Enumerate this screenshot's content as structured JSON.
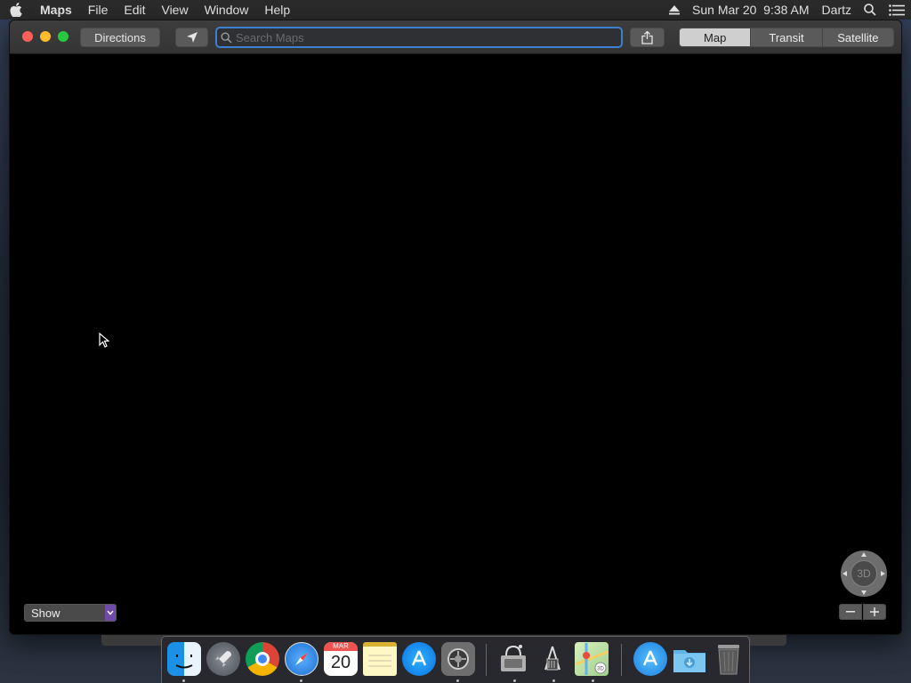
{
  "menubar": {
    "app_name": "Maps",
    "menus": [
      "File",
      "Edit",
      "View",
      "Window",
      "Help"
    ],
    "clock": "Sun Mar 20  9:38 AM",
    "user": "Dartz"
  },
  "toolbar": {
    "directions_label": "Directions",
    "search_placeholder": "Search Maps",
    "search_value": "",
    "view_modes": [
      "Map",
      "Transit",
      "Satellite"
    ],
    "active_view_mode": "Map"
  },
  "map_controls": {
    "show_label": "Show",
    "compass_label": "3D"
  },
  "dock": {
    "apps": [
      {
        "name": "Finder",
        "icon": "finder-icon"
      },
      {
        "name": "Launchpad",
        "icon": "launchpad-icon"
      },
      {
        "name": "Google Chrome",
        "icon": "chrome-icon"
      },
      {
        "name": "Safari",
        "icon": "safari-icon"
      },
      {
        "name": "Calendar",
        "icon": "calendar-icon",
        "month": "MAR",
        "day": "20"
      },
      {
        "name": "Notes",
        "icon": "notes-icon"
      },
      {
        "name": "App Store",
        "icon": "app-store-icon"
      },
      {
        "name": "System Preferences",
        "icon": "system-preferences-icon"
      },
      {
        "name": "Disk Utility",
        "icon": "disk-utility-icon"
      },
      {
        "name": "System Information",
        "icon": "system-information-icon"
      },
      {
        "name": "Maps",
        "icon": "maps-icon"
      },
      {
        "name": "App Store Downloads",
        "icon": "app-store-downloads-icon"
      },
      {
        "name": "Downloads",
        "icon": "downloads-folder-icon"
      },
      {
        "name": "Trash",
        "icon": "trash-icon"
      }
    ]
  },
  "colors": {
    "accent": "#3f7fcf",
    "close": "#ff5f57",
    "minimize": "#febc2e",
    "maximize": "#28c840"
  }
}
